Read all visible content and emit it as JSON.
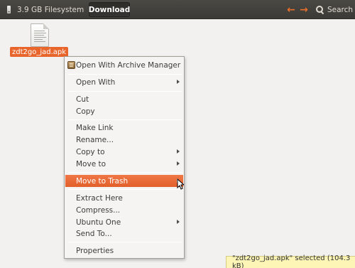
{
  "toolbar": {
    "filesystem_label": "3.9 GB Filesystem",
    "current_folder": "Download",
    "back_icon": "arrow-left-icon",
    "forward_icon": "arrow-right-icon",
    "search_label": "Search",
    "accent_color": "#e8702a"
  },
  "file": {
    "name": "zdt2go_jad.apk",
    "icon": "document-icon"
  },
  "context_menu": {
    "open_with_archive": "Open With Archive Manager",
    "open_with": "Open With",
    "cut": "Cut",
    "copy": "Copy",
    "make_link": "Make Link",
    "rename": "Rename...",
    "copy_to": "Copy to",
    "move_to": "Move to",
    "move_to_trash": "Move to Trash",
    "extract_here": "Extract Here",
    "compress": "Compress...",
    "ubuntu_one": "Ubuntu One",
    "send_to": "Send To...",
    "properties": "Properties",
    "highlight_color": "#e8662c"
  },
  "status_bar": {
    "text": "\"zdt2go_jad.apk\" selected (104.3 kB)"
  }
}
